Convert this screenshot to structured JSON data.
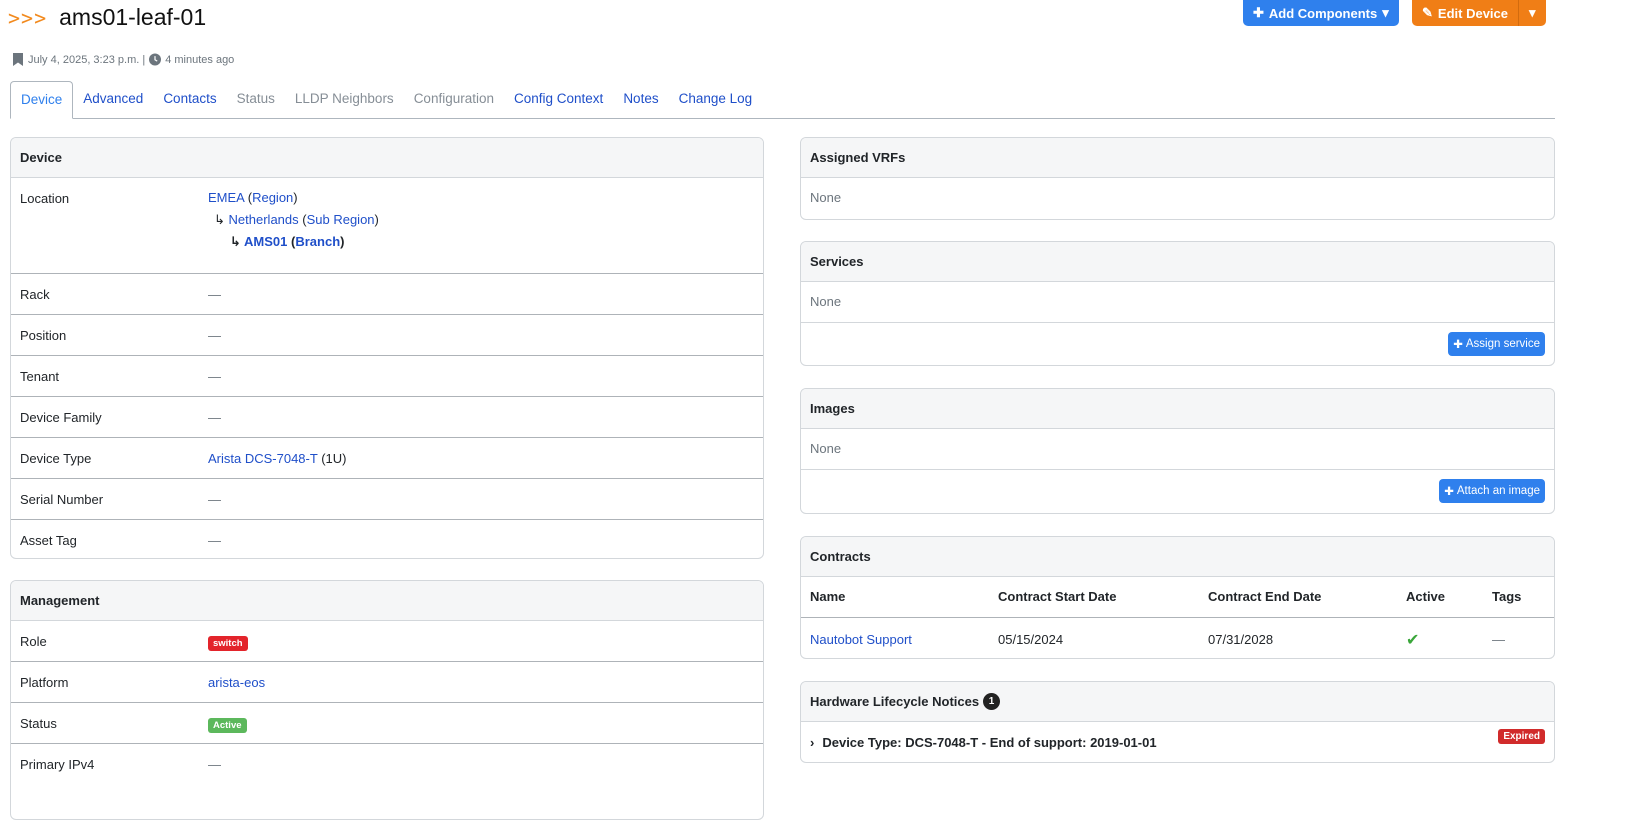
{
  "header": {
    "crumb": ">>>",
    "title": "ams01-leaf-01",
    "created": "July 4, 2025, 3:23 p.m. |",
    "updated": "4 minutes ago",
    "add_components_label": "Add Components",
    "edit_device_label": "Edit Device"
  },
  "tabs": [
    {
      "label": "Device",
      "state": "active"
    },
    {
      "label": "Advanced",
      "state": "enabled"
    },
    {
      "label": "Contacts",
      "state": "enabled"
    },
    {
      "label": "Status",
      "state": "disabled"
    },
    {
      "label": "LLDP Neighbors",
      "state": "disabled"
    },
    {
      "label": "Configuration",
      "state": "disabled"
    },
    {
      "label": "Config Context",
      "state": "enabled"
    },
    {
      "label": "Notes",
      "state": "enabled"
    },
    {
      "label": "Change Log",
      "state": "enabled"
    }
  ],
  "device_panel": {
    "title": "Device",
    "location_label": "Location",
    "location": {
      "l1_name": "EMEA",
      "l1_type": "Region",
      "l2_name": "Netherlands",
      "l2_type": "Sub Region",
      "l3_name": "AMS01",
      "l3_type": "Branch",
      "tree_glyph": "↳"
    },
    "rack_label": "Rack",
    "rack_value": "—",
    "position_label": "Position",
    "position_value": "—",
    "tenant_label": "Tenant",
    "tenant_value": "—",
    "family_label": "Device Family",
    "family_value": "—",
    "type_label": "Device Type",
    "type_value": "Arista DCS-7048-T",
    "type_units": "(1U)",
    "serial_label": "Serial Number",
    "serial_value": "—",
    "asset_label": "Asset Tag",
    "asset_value": "—"
  },
  "management_panel": {
    "title": "Management",
    "role_label": "Role",
    "role_value": "switch",
    "platform_label": "Platform",
    "platform_value": "arista-eos",
    "status_label": "Status",
    "status_value": "Active",
    "ipv4_label": "Primary IPv4",
    "ipv4_value": "—"
  },
  "vrfs_panel": {
    "title": "Assigned VRFs",
    "body": "None"
  },
  "services_panel": {
    "title": "Services",
    "body": "None",
    "button": "Assign service"
  },
  "images_panel": {
    "title": "Images",
    "body": "None",
    "button": "Attach an image"
  },
  "contracts_panel": {
    "title": "Contracts",
    "columns": [
      "Name",
      "Contract Start Date",
      "Contract End Date",
      "Active",
      "Tags"
    ],
    "rows": [
      {
        "name": "Nautobot Support",
        "start": "05/15/2024",
        "end": "07/31/2028",
        "active": "✔",
        "tags": "—"
      }
    ]
  },
  "lifecycle_panel": {
    "title": "Hardware Lifecycle Notices",
    "count": "1",
    "notice": "Device Type: DCS-7048-T - End of support: 2019-01-01",
    "badge": "Expired"
  },
  "colors": {
    "primary": "#2f80ed",
    "warning": "#f07e16",
    "danger": "#e3242b",
    "success": "#5cb85c",
    "link": "#1f4fc9"
  }
}
